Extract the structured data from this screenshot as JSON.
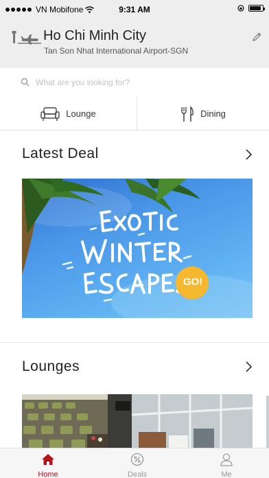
{
  "status_bar": {
    "carrier": "VN Mobifone",
    "time": "9:31 AM",
    "battery_level": 0.9
  },
  "location": {
    "city": "Ho Chi Minh City",
    "airport": "Tan Son Nhat International Airport-SGN",
    "icon": "airport-icon",
    "edit_icon": "pencil-icon"
  },
  "search": {
    "placeholder": "What are you looking for?",
    "icon": "search-icon"
  },
  "quick_links": [
    {
      "label": "Lounge",
      "icon": "armchair-icon"
    },
    {
      "label": "Dining",
      "icon": "fork-knife-icon"
    }
  ],
  "sections": {
    "latest_deal": {
      "title": "Latest Deal",
      "banner": {
        "line1": "EXOTIC",
        "line2": "WINTER",
        "line3": "ESCAPES",
        "badge": "GO!"
      }
    },
    "lounges": {
      "title": "Lounges"
    }
  },
  "tab_bar": {
    "tabs": [
      {
        "label": "Home",
        "icon": "home-icon",
        "active": true
      },
      {
        "label": "Deals",
        "icon": "percent-icon",
        "active": false
      },
      {
        "label": "Me",
        "icon": "user-icon",
        "active": false
      }
    ]
  },
  "colors": {
    "accent": "#b3121b",
    "header_bg": "#eeeeee",
    "badge": "#f5b82e",
    "inactive_tab": "#9a9a9a"
  }
}
